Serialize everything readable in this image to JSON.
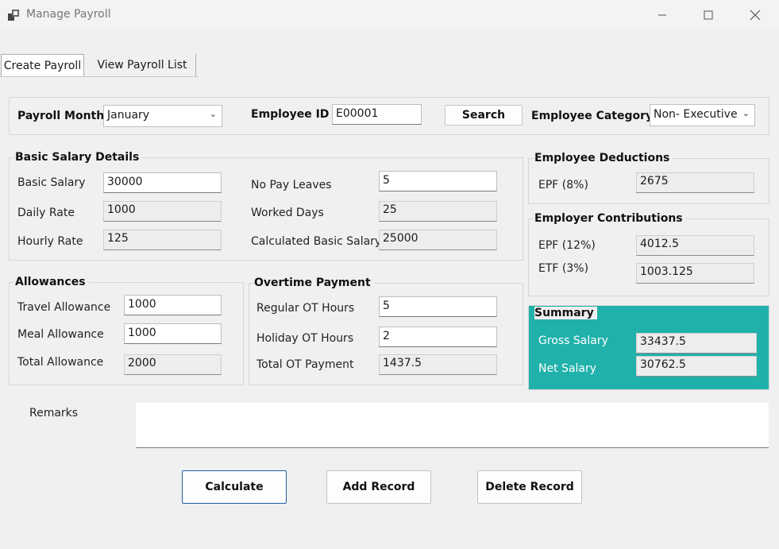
{
  "window": {
    "title": "Manage Payroll",
    "minimize_icon": "minimize-icon",
    "maximize_icon": "maximize-icon",
    "close_icon": "close-icon"
  },
  "tabs": [
    {
      "label": "Create Payroll",
      "active": true
    },
    {
      "label": "View Payroll List",
      "active": false
    }
  ],
  "top": {
    "payroll_month_label": "Payroll Month",
    "payroll_month_value": "January",
    "employee_id_label": "Employee ID",
    "employee_id_value": "E00001",
    "search_label": "Search",
    "category_label": "Employee Category",
    "category_value": "Non- Executive"
  },
  "basic": {
    "title": "Basic Salary Details",
    "basic_salary_label": "Basic Salary",
    "basic_salary": "30000",
    "daily_rate_label": "Daily Rate",
    "daily_rate": "1000",
    "hourly_rate_label": "Hourly Rate",
    "hourly_rate": "125",
    "no_pay_leaves_label": "No Pay Leaves",
    "no_pay_leaves": "5",
    "worked_days_label": "Worked Days",
    "worked_days": "25",
    "calculated_basic_label": "Calculated Basic Salary",
    "calculated_basic": "25000"
  },
  "deductions": {
    "title": "Employee Deductions",
    "epf_label": "EPF (8%)",
    "epf": "2675"
  },
  "contributions": {
    "title": "Employer Contributions",
    "epf_label": "EPF (12%)",
    "epf": "4012.5",
    "etf_label": "ETF (3%)",
    "etf": "1003.125"
  },
  "allowances": {
    "title": "Allowances",
    "travel_label": "Travel Allowance",
    "travel": "1000",
    "meal_label": "Meal Allowance",
    "meal": "1000",
    "total_label": "Total Allowance",
    "total": "2000"
  },
  "overtime": {
    "title": "Overtime Payment",
    "regular_label": "Regular OT Hours",
    "regular": "5",
    "holiday_label": "Holiday OT Hours",
    "holiday": "2",
    "total_label": "Total OT Payment",
    "total": "1437.5"
  },
  "summary": {
    "title": "Summary",
    "gross_label": "Gross Salary",
    "gross": "33437.5",
    "net_label": "Net Salary",
    "net": "30762.5",
    "color": "#20b2aa"
  },
  "remarks": {
    "label": "Remarks",
    "value": ""
  },
  "actions": {
    "calculate": "Calculate",
    "add": "Add Record",
    "delete": "Delete Record"
  }
}
